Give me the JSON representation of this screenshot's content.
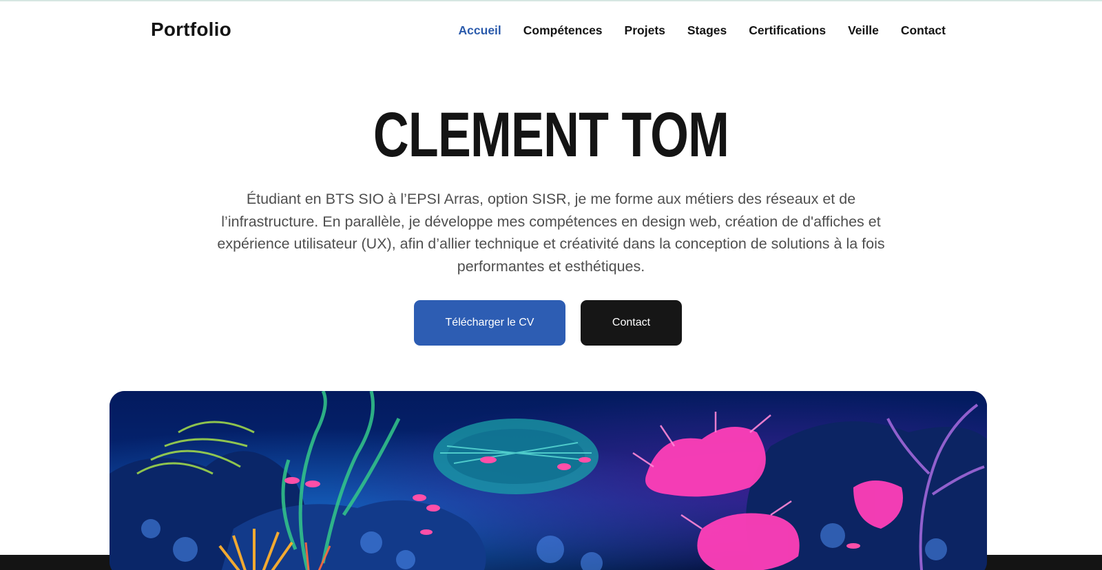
{
  "header": {
    "logo": "Portfolio",
    "nav": [
      {
        "label": "Accueil",
        "active": true
      },
      {
        "label": "Compétences",
        "active": false
      },
      {
        "label": "Projets",
        "active": false
      },
      {
        "label": "Stages",
        "active": false
      },
      {
        "label": "Certifications",
        "active": false
      },
      {
        "label": "Veille",
        "active": false
      },
      {
        "label": "Contact",
        "active": false
      }
    ]
  },
  "hero": {
    "title": "CLEMENT TOM",
    "description": "Étudiant en BTS SIO à l’EPSI Arras, option SISR, je me forme aux métiers des réseaux et de l’infrastructure. En parallèle, je développe mes compétences en design web, création de d'affiches et expérience utilisateur (UX), afin d’allier technique et créativité dans la conception de solutions à la fois performantes et esthétiques.",
    "cv_button": "Télécharger le CV",
    "contact_button": "Contact",
    "image": "underwater-coral-reef-neon"
  },
  "colors": {
    "accent": "#2d5db3",
    "active_nav": "#2a5aab",
    "dark": "#141414",
    "text_muted": "#4f4f4f"
  }
}
